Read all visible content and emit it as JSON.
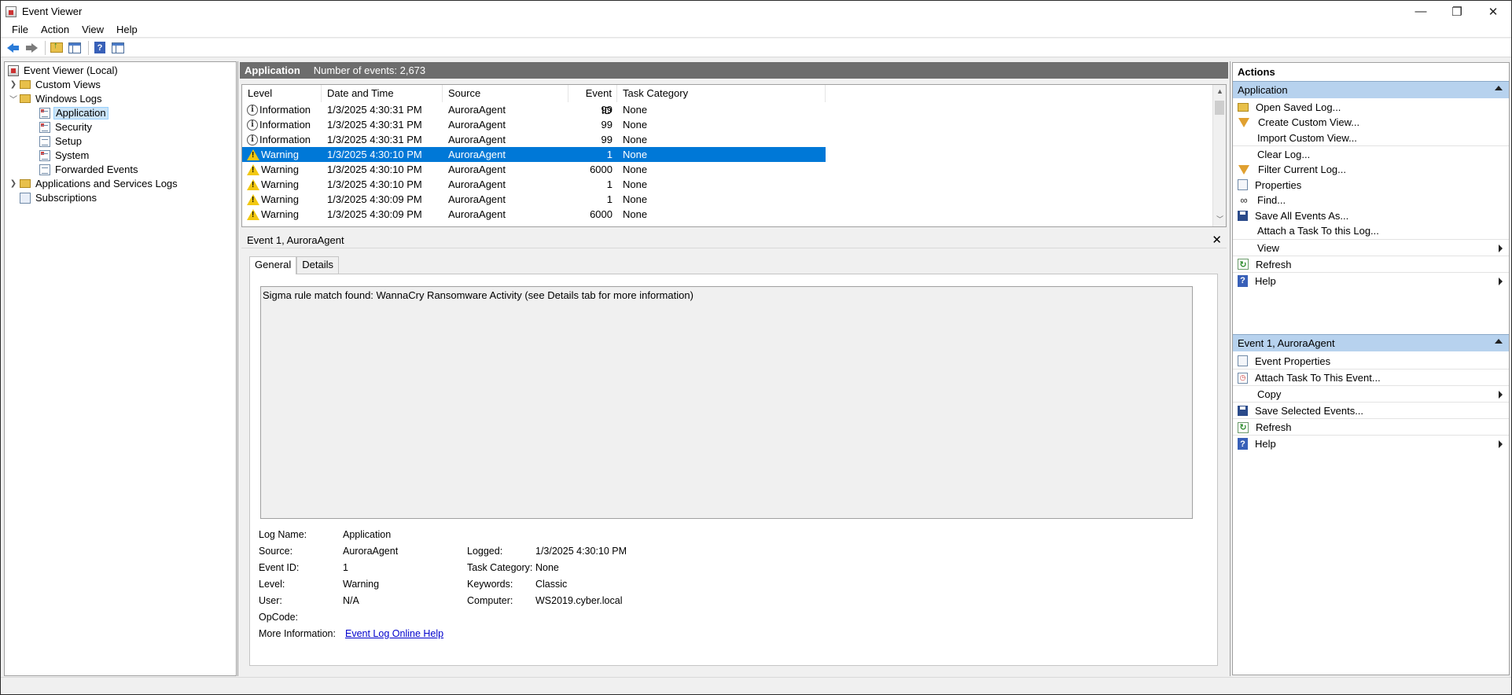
{
  "window": {
    "title": "Event Viewer",
    "minimize": "—",
    "restore": "❐",
    "close": "✕"
  },
  "menu": [
    "File",
    "Action",
    "View",
    "Help"
  ],
  "tree": {
    "root": "Event Viewer (Local)",
    "custom_views": "Custom Views",
    "windows_logs": "Windows Logs",
    "logs": [
      "Application",
      "Security",
      "Setup",
      "System",
      "Forwarded Events"
    ],
    "apps_services": "Applications and Services Logs",
    "subscriptions": "Subscriptions",
    "selected": "Application"
  },
  "center": {
    "log_name": "Application",
    "count_text": "Number of events: 2,673",
    "columns": [
      "Level",
      "Date and Time",
      "Source",
      "Event ID",
      "Task Category"
    ],
    "rows": [
      {
        "level": "Information",
        "icon": "info-icon",
        "date": "1/3/2025 4:30:31 PM",
        "source": "AuroraAgent",
        "id": "99",
        "category": "None"
      },
      {
        "level": "Information",
        "icon": "info-icon",
        "date": "1/3/2025 4:30:31 PM",
        "source": "AuroraAgent",
        "id": "99",
        "category": "None"
      },
      {
        "level": "Information",
        "icon": "info-icon",
        "date": "1/3/2025 4:30:31 PM",
        "source": "AuroraAgent",
        "id": "99",
        "category": "None"
      },
      {
        "level": "Warning",
        "icon": "warning-icon",
        "date": "1/3/2025 4:30:10 PM",
        "source": "AuroraAgent",
        "id": "1",
        "category": "None",
        "selected": true
      },
      {
        "level": "Warning",
        "icon": "warning-icon",
        "date": "1/3/2025 4:30:10 PM",
        "source": "AuroraAgent",
        "id": "6000",
        "category": "None"
      },
      {
        "level": "Warning",
        "icon": "warning-icon",
        "date": "1/3/2025 4:30:10 PM",
        "source": "AuroraAgent",
        "id": "1",
        "category": "None"
      },
      {
        "level": "Warning",
        "icon": "warning-icon",
        "date": "1/3/2025 4:30:09 PM",
        "source": "AuroraAgent",
        "id": "1",
        "category": "None"
      },
      {
        "level": "Warning",
        "icon": "warning-icon",
        "date": "1/3/2025 4:30:09 PM",
        "source": "AuroraAgent",
        "id": "6000",
        "category": "None"
      }
    ]
  },
  "detail": {
    "title": "Event 1, AuroraAgent",
    "tabs": [
      "General",
      "Details"
    ],
    "active_tab": "General",
    "description": "Sigma rule match found: WannaCry Ransomware Activity (see Details tab for more information)",
    "fields": {
      "log_name_label": "Log Name:",
      "log_name": "Application",
      "source_label": "Source:",
      "source": "AuroraAgent",
      "logged_label": "Logged:",
      "logged": "1/3/2025 4:30:10 PM",
      "event_id_label": "Event ID:",
      "event_id": "1",
      "task_cat_label": "Task Category:",
      "task_cat": "None",
      "level_label": "Level:",
      "level": "Warning",
      "keywords_label": "Keywords:",
      "keywords": "Classic",
      "user_label": "User:",
      "user": "N/A",
      "computer_label": "Computer:",
      "computer": "WS2019.cyber.local",
      "opcode_label": "OpCode:",
      "more_info_label": "More Information:",
      "more_info_link": "Event Log Online Help"
    }
  },
  "actions": {
    "title": "Actions",
    "section1": "Application",
    "items1": [
      {
        "label": "Open Saved Log...",
        "icon": "open-folder-icon"
      },
      {
        "label": "Create Custom View...",
        "icon": "filter-icon"
      },
      {
        "label": "Import Custom View...",
        "icon": ""
      },
      {
        "label": "Clear Log...",
        "icon": ""
      },
      {
        "label": "Filter Current Log...",
        "icon": "filter-icon"
      },
      {
        "label": "Properties",
        "icon": "properties-icon"
      },
      {
        "label": "Find...",
        "icon": "binoculars-icon"
      },
      {
        "label": "Save All Events As...",
        "icon": "save-icon"
      },
      {
        "label": "Attach a Task To this Log...",
        "icon": ""
      },
      {
        "label": "View",
        "icon": "",
        "submenu": true
      },
      {
        "label": "Refresh",
        "icon": "refresh-icon"
      },
      {
        "label": "Help",
        "icon": "help-icon",
        "submenu": true
      }
    ],
    "section2": "Event 1, AuroraAgent",
    "items2": [
      {
        "label": "Event Properties",
        "icon": "properties-icon"
      },
      {
        "label": "Attach Task To This Event...",
        "icon": "task-icon"
      },
      {
        "label": "Copy",
        "icon": "",
        "submenu": true
      },
      {
        "label": "Save Selected Events...",
        "icon": "save-icon"
      },
      {
        "label": "Refresh",
        "icon": "refresh-icon"
      },
      {
        "label": "Help",
        "icon": "help-icon",
        "submenu": true
      }
    ]
  },
  "colors": {
    "selection": "#0078d7",
    "section_header": "#b7d2ee",
    "center_header": "#6d6d6d"
  }
}
